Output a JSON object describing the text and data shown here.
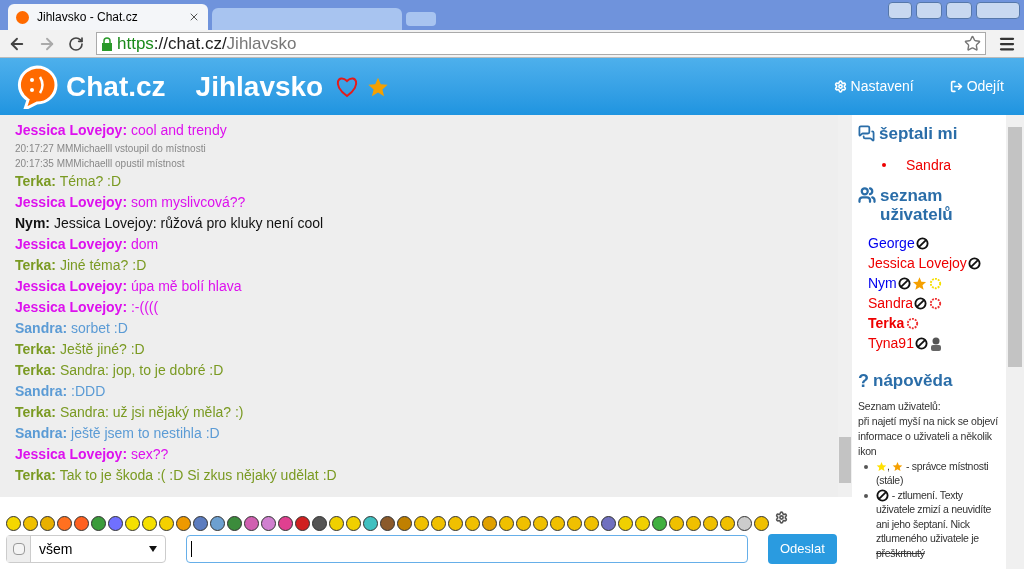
{
  "browser": {
    "tab_title": "Jihlavsko - Chat.cz",
    "url_scheme": "https",
    "url_rest": "://chat.cz/",
    "url_path": "Jihlavsko"
  },
  "header": {
    "logo": "Chat.cz",
    "room": "Jihlavsko",
    "favorite": false,
    "starred": true,
    "links": [
      {
        "kind": "settings",
        "label": "Nastavení"
      },
      {
        "kind": "exit",
        "label": "Odejít"
      }
    ]
  },
  "messages": [
    {
      "kind": "message",
      "user": "Jessica Lovejoy:",
      "text": "cool and trendy",
      "color": "#dd11ee"
    },
    {
      "kind": "system",
      "text": "20:17:27 MMMichaelll vstoupil do místnosti"
    },
    {
      "kind": "system",
      "text": "20:17:35 MMMichaelll opustil místnost"
    },
    {
      "kind": "message",
      "user": "Terka:",
      "text": "Téma? :D",
      "color": "#7a9a22"
    },
    {
      "kind": "message",
      "user": "Jessica Lovejoy:",
      "text": "som myslivcová??",
      "color": "#dd11ee"
    },
    {
      "kind": "message",
      "user": "Nym:",
      "text": "Jessica Lovejoy: růžová pro kluky není cool",
      "color": "#111111"
    },
    {
      "kind": "message",
      "user": "Jessica Lovejoy:",
      "text": "dom",
      "color": "#dd11ee"
    },
    {
      "kind": "message",
      "user": "Terka:",
      "text": "Jiné téma? :D",
      "color": "#7a9a22"
    },
    {
      "kind": "message",
      "user": "Jessica Lovejoy:",
      "text": "úpa mě bolí hlava",
      "color": "#dd11ee"
    },
    {
      "kind": "message",
      "user": "Jessica Lovejoy:",
      "text": ":-((((",
      "color": "#dd11ee"
    },
    {
      "kind": "message",
      "user": "Sandra:",
      "text": "sorbet :D",
      "color": "#5b9bd5"
    },
    {
      "kind": "message",
      "user": "Terka:",
      "text": "Ještě jiné? :D",
      "color": "#7a9a22"
    },
    {
      "kind": "message",
      "user": "Terka:",
      "text": "Sandra: jop, to je dobré :D",
      "color": "#7a9a22"
    },
    {
      "kind": "message",
      "user": "Sandra:",
      "text": ":DDD",
      "color": "#5b9bd5"
    },
    {
      "kind": "message",
      "user": "Terka:",
      "text": "Sandra: už jsi nějaký měla? :)",
      "color": "#7a9a22"
    },
    {
      "kind": "message",
      "user": "Sandra:",
      "text": "ještě jsem to nestihla :D",
      "color": "#5b9bd5"
    },
    {
      "kind": "message",
      "user": "Jessica Lovejoy:",
      "text": "sex??",
      "color": "#dd11ee"
    },
    {
      "kind": "message",
      "user": "Terka:",
      "text": "Tak to je škoda :( :D Si zkus nějaký udělat :D",
      "color": "#7a9a22"
    }
  ],
  "composer": {
    "private": false,
    "recipient": "všem",
    "send": "Odeslat"
  },
  "sidebar": {
    "whispers_title": "šeptali mi",
    "whispers": [
      "Sandra"
    ],
    "users_title": "seznam uživatelů",
    "users": [
      {
        "name": "George",
        "color": "#0000ee",
        "bold": false,
        "icons": [
          {
            "kind": "muted"
          }
        ]
      },
      {
        "name": "Jessica Lovejoy",
        "color": "#ee0000",
        "bold": false,
        "icons": [
          {
            "kind": "muted"
          }
        ]
      },
      {
        "name": "Nym",
        "color": "#0000ee",
        "bold": false,
        "icons": [
          {
            "kind": "muted"
          },
          {
            "kind": "star"
          },
          {
            "kind": "sun"
          }
        ]
      },
      {
        "name": "Sandra",
        "color": "#ee0000",
        "bold": false,
        "icons": [
          {
            "kind": "muted"
          },
          {
            "kind": "ring"
          }
        ]
      },
      {
        "name": "Terka",
        "color": "#ee0000",
        "bold": true,
        "icons": [
          {
            "kind": "ring"
          }
        ]
      },
      {
        "name": "Tyna91",
        "color": "#ee0000",
        "bold": false,
        "icons": [
          {
            "kind": "muted"
          },
          {
            "kind": "spy"
          }
        ]
      }
    ],
    "help_icon": "?",
    "help_title": "nápověda",
    "help_intro": "Seznam uživatelů:\npři najetí myší na nick se objeví informace o uživateli a několik ikon",
    "help_items": [
      {
        "kind": "stars",
        "separator": ",",
        "text": "- správce místnosti (stále)"
      },
      {
        "kind": "muted",
        "text": "- ztlumení. Texty uživatele zmizí a neuvidíte ani jeho šeptaní. Nick ztlumeného uživatele je",
        "struck": "přeškrtnutý"
      }
    ]
  }
}
